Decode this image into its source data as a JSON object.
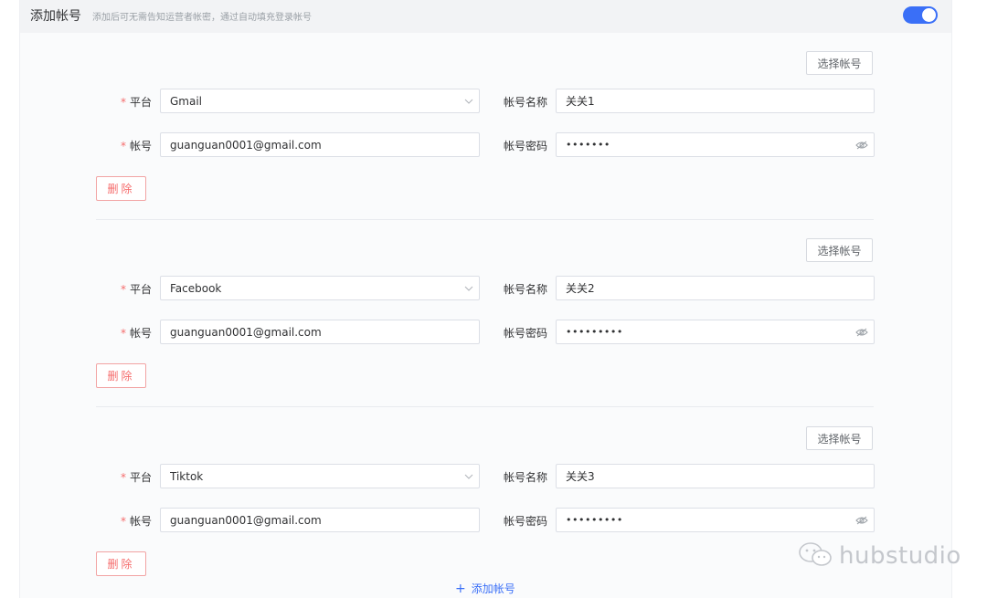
{
  "header": {
    "title": "添加帐号",
    "hint": "添加后可无需告知运营者帐密，通过自动填充登录帐号",
    "toggle_on": true
  },
  "labels": {
    "platform": "平台",
    "account": "帐号",
    "account_name": "帐号名称",
    "account_password": "帐号密码",
    "required_mark": "*",
    "select_account": "选择帐号",
    "delete": "删除"
  },
  "accounts": [
    {
      "platform": "Gmail",
      "account": "guanguan0001@gmail.com",
      "name": "关关1",
      "password_mask": "•••••••"
    },
    {
      "platform": "Facebook",
      "account": "guanguan0001@gmail.com",
      "name": "关关2",
      "password_mask": "•••••••••"
    },
    {
      "platform": "Tiktok",
      "account": "guanguan0001@gmail.com",
      "name": "关关3",
      "password_mask": "•••••••••"
    }
  ],
  "footer": {
    "add_account_icon": "+",
    "add_account_label": "添加帐号"
  },
  "watermark": {
    "text": "hubstudio",
    "icon": "wechat-icon"
  },
  "colors": {
    "accent": "#3a6ff7",
    "danger": "#f56c6c"
  }
}
